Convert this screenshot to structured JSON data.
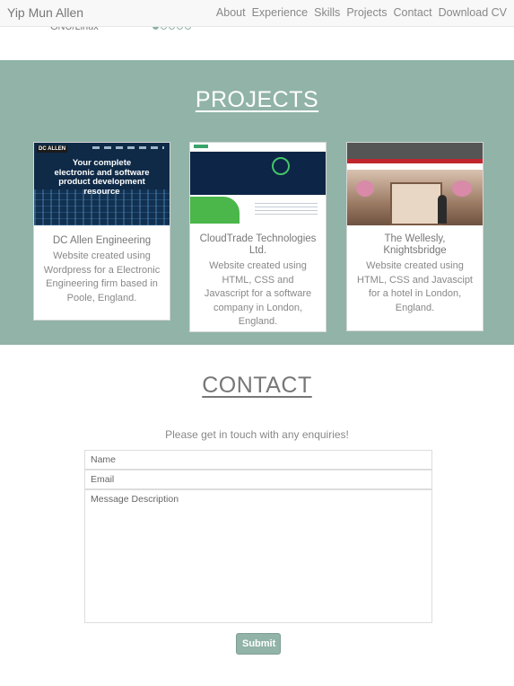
{
  "navbar": {
    "brand": "Yip Mun Allen",
    "links": [
      "About",
      "Experience",
      "Skills",
      "Projects",
      "Contact",
      "Download CV"
    ]
  },
  "skills": {
    "partial_row_label": "GNU/Linux",
    "rating": 1,
    "rating_max": 5
  },
  "projects": {
    "title": "PROJECTS",
    "cards": [
      {
        "thumb_logo": "DC ALLEN",
        "thumb_headline": "Your complete electronic and software product development resource",
        "title": "DC Allen Engineering",
        "description": "Website created using Wordpress for a Electronic Engineering firm based in Poole, England."
      },
      {
        "title": "CloudTrade Technologies Ltd.",
        "description": "Website created using HTML, CSS and Javascript for a software company in London, England."
      },
      {
        "title": "The Wellesly, Knightsbridge",
        "description": "Website created using HTML, CSS and Javascipt for a hotel in London, England."
      }
    ]
  },
  "contact": {
    "title": "CONTACT",
    "subtitle": "Please get in touch with any enquiries!",
    "name_placeholder": "Name",
    "email_placeholder": "Email",
    "message_placeholder": "Message Description",
    "submit_label": "Submit"
  },
  "colors": {
    "accent": "#91b3a8",
    "navbar_bg": "#f8f8f8"
  }
}
